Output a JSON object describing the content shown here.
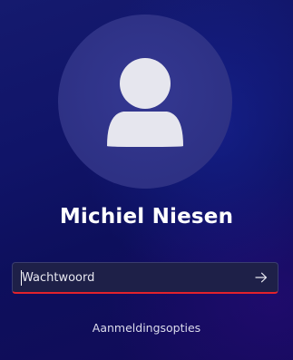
{
  "user": {
    "name": "Michiel Niesen",
    "avatar_icon": "person-icon"
  },
  "password": {
    "value": "",
    "placeholder": "Wachtwoord",
    "submit_icon": "arrow-right-icon",
    "error_underline_color": "#e3222c"
  },
  "sign_in_options_label": "Aanmeldingsopties",
  "colors": {
    "background": "#101468",
    "avatar_circle": "#2c2f80",
    "avatar_glyph": "#e6e6ee"
  }
}
